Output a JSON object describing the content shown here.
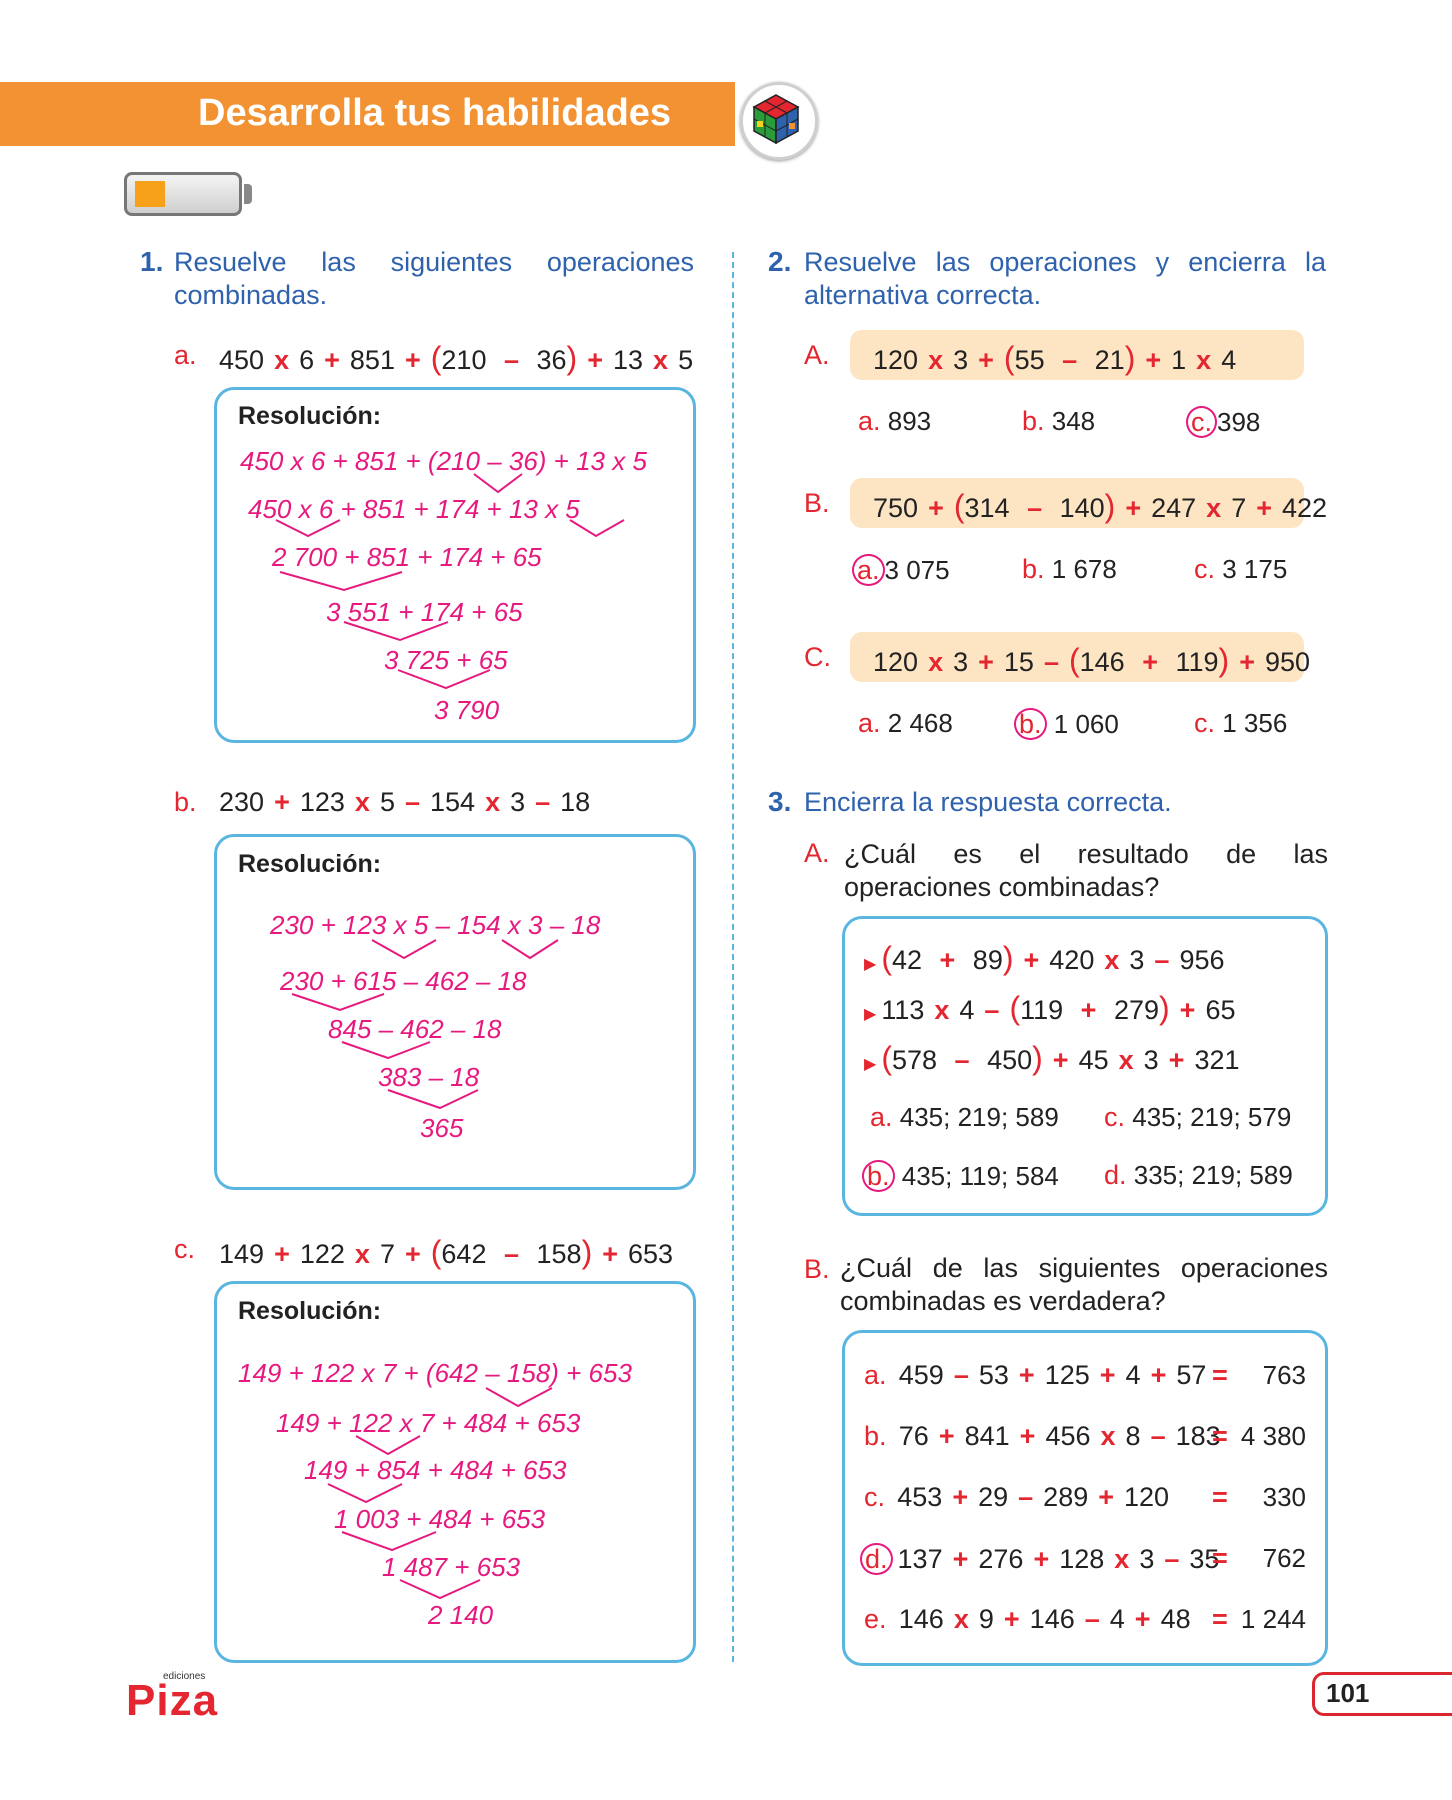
{
  "header": {
    "title": "Desarrolla tus habilidades"
  },
  "page_number": "101",
  "publisher": {
    "logo_text": "Piza",
    "small_text": "ediciones"
  },
  "q1": {
    "number": "1.",
    "text_line1": "Resuelve las siguientes operaciones",
    "text_line2": "combinadas.",
    "resolution_label": "Resolución:",
    "a": {
      "label": "a.",
      "expr": [
        [
          "450"
        ],
        [
          "x",
          "op"
        ],
        [
          "6"
        ],
        [
          "+",
          "op"
        ],
        [
          "851"
        ],
        [
          "+",
          "op"
        ],
        [
          "(210 ",
          "paren"
        ],
        [
          "–",
          "op"
        ],
        [
          " 36)",
          "paren"
        ],
        [
          "+",
          "op"
        ],
        [
          "13"
        ],
        [
          "x",
          "op"
        ],
        [
          "5"
        ]
      ],
      "steps": [
        "450 x 6 + 851 + (210 – 36) + 13 x 5",
        "450 x 6 + 851 + 174 + 13 x 5",
        "2 700 + 851 + 174 + 65",
        "3 551 + 174 + 65",
        "3 725 + 65",
        "3 790"
      ]
    },
    "b": {
      "label": "b.",
      "expr": [
        [
          "230"
        ],
        [
          "+",
          "op"
        ],
        [
          "123"
        ],
        [
          "x",
          "op"
        ],
        [
          "5"
        ],
        [
          "–",
          "op"
        ],
        [
          "154"
        ],
        [
          "x",
          "op"
        ],
        [
          "3"
        ],
        [
          "–",
          "op"
        ],
        [
          "18"
        ]
      ],
      "steps": [
        "230 + 123 x 5 – 154 x 3 – 18",
        "230 + 615 – 462 – 18",
        "845 – 462 – 18",
        "383 – 18",
        "365"
      ]
    },
    "c": {
      "label": "c.",
      "expr": [
        [
          "149"
        ],
        [
          "+",
          "op"
        ],
        [
          "122"
        ],
        [
          "x",
          "op"
        ],
        [
          "7"
        ],
        [
          "+",
          "op"
        ],
        [
          "(642 ",
          "paren"
        ],
        [
          "–",
          "op"
        ],
        [
          " 158)",
          "paren"
        ],
        [
          "+",
          "op"
        ],
        [
          "653"
        ]
      ],
      "steps": [
        "149 + 122 x 7 + (642 – 158) + 653",
        "149 + 122 x 7 + 484 + 653",
        "149 + 854 + 484 + 653",
        "1 003 + 484 + 653",
        "1 487 + 653",
        "2 140"
      ]
    }
  },
  "q2": {
    "number": "2.",
    "text_line1": "Resuelve las operaciones y encierra la",
    "text_line2": "alternativa correcta.",
    "items": [
      {
        "label": "A.",
        "expr": [
          [
            "120"
          ],
          [
            "x",
            "op"
          ],
          [
            "3"
          ],
          [
            "+",
            "op"
          ],
          [
            "(55 ",
            "paren"
          ],
          [
            "–",
            "op"
          ],
          [
            " 21)",
            "paren"
          ],
          [
            "+",
            "op"
          ],
          [
            "1"
          ],
          [
            "x",
            "op"
          ],
          [
            "4"
          ]
        ],
        "options": [
          {
            "l": "a.",
            "v": "893",
            "c": false
          },
          {
            "l": "b.",
            "v": "348",
            "c": false
          },
          {
            "l": "c.",
            "v": "398",
            "c": true
          }
        ]
      },
      {
        "label": "B.",
        "expr": [
          [
            "750"
          ],
          [
            "+",
            "op"
          ],
          [
            "(314 ",
            "paren"
          ],
          [
            "–",
            "op"
          ],
          [
            " 140)",
            "paren"
          ],
          [
            "+",
            "op"
          ],
          [
            "247"
          ],
          [
            "x",
            "op"
          ],
          [
            "7"
          ],
          [
            "+",
            "op"
          ],
          [
            "422"
          ]
        ],
        "options": [
          {
            "l": "a.",
            "v": "3 075",
            "c": true
          },
          {
            "l": "b.",
            "v": "1 678",
            "c": false
          },
          {
            "l": "c.",
            "v": "3 175",
            "c": false
          }
        ]
      },
      {
        "label": "C.",
        "expr": [
          [
            "120"
          ],
          [
            "x",
            "op"
          ],
          [
            "3"
          ],
          [
            "+",
            "op"
          ],
          [
            "15"
          ],
          [
            "–",
            "op"
          ],
          [
            "(146 ",
            "paren"
          ],
          [
            "+",
            "op"
          ],
          [
            " 119)",
            "paren"
          ],
          [
            "+",
            "op"
          ],
          [
            "950"
          ]
        ],
        "options": [
          {
            "l": "a.",
            "v": "2 468",
            "c": false
          },
          {
            "l": "b.",
            "v": "1 060",
            "c": true
          },
          {
            "l": "c.",
            "v": "1 356",
            "c": false
          }
        ]
      }
    ]
  },
  "q3": {
    "number": "3.",
    "text": "Encierra la respuesta correcta.",
    "A": {
      "label": "A.",
      "text_line1": "¿Cuál es el resultado de las",
      "text_line2": "operaciones combinadas?",
      "lines": [
        [
          [
            "(42 ",
            "paren"
          ],
          [
            "+",
            "op"
          ],
          [
            " 89)",
            "paren"
          ],
          [
            "+",
            "op"
          ],
          [
            "420"
          ],
          [
            "x",
            "op"
          ],
          [
            "3"
          ],
          [
            "–",
            "op"
          ],
          [
            "956"
          ]
        ],
        [
          [
            "113"
          ],
          [
            "x",
            "op"
          ],
          [
            "4"
          ],
          [
            "–",
            "op"
          ],
          [
            "(119 ",
            "paren"
          ],
          [
            "+",
            "op"
          ],
          [
            " 279)",
            "paren"
          ],
          [
            "+",
            "op"
          ],
          [
            "65"
          ]
        ],
        [
          [
            "(578 ",
            "paren"
          ],
          [
            "–",
            "op"
          ],
          [
            " 450)",
            "paren"
          ],
          [
            "+",
            "op"
          ],
          [
            "45"
          ],
          [
            "x",
            "op"
          ],
          [
            "3"
          ],
          [
            "+",
            "op"
          ],
          [
            "321"
          ]
        ]
      ],
      "options": [
        {
          "l": "a.",
          "v": "435; 219; 589",
          "c": false
        },
        {
          "l": "c.",
          "v": "435; 219; 579",
          "c": false
        },
        {
          "l": "b.",
          "v": "435; 119; 584",
          "c": true
        },
        {
          "l": "d.",
          "v": "335; 219; 589",
          "c": false
        }
      ]
    },
    "B": {
      "label": "B.",
      "text_line1": "¿Cuál de las siguientes operaciones",
      "text_line2": "combinadas es verdadera?",
      "rows": [
        {
          "l": "a.",
          "c": false,
          "expr": [
            [
              "459"
            ],
            [
              "–",
              "op"
            ],
            [
              "53"
            ],
            [
              "+",
              "op"
            ],
            [
              "125"
            ],
            [
              "+",
              "op"
            ],
            [
              "4"
            ],
            [
              "+",
              "op"
            ],
            [
              "57"
            ]
          ],
          "result": "763"
        },
        {
          "l": "b.",
          "c": false,
          "expr": [
            [
              "76"
            ],
            [
              "+",
              "op"
            ],
            [
              "841"
            ],
            [
              "+",
              "op"
            ],
            [
              "456"
            ],
            [
              "x",
              "op"
            ],
            [
              "8"
            ],
            [
              "–",
              "op"
            ],
            [
              "183"
            ]
          ],
          "result": "4 380"
        },
        {
          "l": "c.",
          "c": false,
          "expr": [
            [
              "453"
            ],
            [
              "+",
              "op"
            ],
            [
              "29"
            ],
            [
              "–",
              "op"
            ],
            [
              "289"
            ],
            [
              "+",
              "op"
            ],
            [
              "120"
            ]
          ],
          "result": "330"
        },
        {
          "l": "d.",
          "c": true,
          "expr": [
            [
              "137"
            ],
            [
              "+",
              "op"
            ],
            [
              "276"
            ],
            [
              "+",
              "op"
            ],
            [
              "128"
            ],
            [
              "x",
              "op"
            ],
            [
              "3"
            ],
            [
              "–",
              "op"
            ],
            [
              "35"
            ]
          ],
          "result": "762"
        },
        {
          "l": "e.",
          "c": false,
          "expr": [
            [
              "146"
            ],
            [
              "x",
              "op"
            ],
            [
              "9"
            ],
            [
              "+",
              "op"
            ],
            [
              "146"
            ],
            [
              "–",
              "op"
            ],
            [
              "4"
            ],
            [
              "+",
              "op"
            ],
            [
              "48"
            ]
          ],
          "result": "1 244"
        }
      ]
    }
  }
}
